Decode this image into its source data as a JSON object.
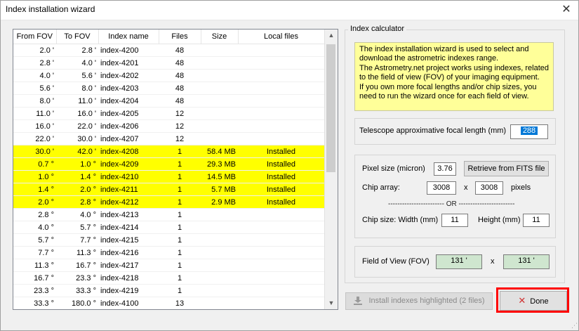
{
  "window": {
    "title": "Index installation wizard",
    "close_icon": "close-icon"
  },
  "table": {
    "headers": [
      "From FOV",
      "To FOV",
      "Index name",
      "Files",
      "Size",
      "Local files"
    ],
    "rows": [
      {
        "from": "2.0 '",
        "to": "2.8 '",
        "name": "index-4200",
        "files": "48",
        "size": "",
        "local": "",
        "hl": false
      },
      {
        "from": "2.8 '",
        "to": "4.0 '",
        "name": "index-4201",
        "files": "48",
        "size": "",
        "local": "",
        "hl": false
      },
      {
        "from": "4.0 '",
        "to": "5.6 '",
        "name": "index-4202",
        "files": "48",
        "size": "",
        "local": "",
        "hl": false
      },
      {
        "from": "5.6 '",
        "to": "8.0 '",
        "name": "index-4203",
        "files": "48",
        "size": "",
        "local": "",
        "hl": false
      },
      {
        "from": "8.0 '",
        "to": "11.0 '",
        "name": "index-4204",
        "files": "48",
        "size": "",
        "local": "",
        "hl": false
      },
      {
        "from": "11.0 '",
        "to": "16.0 '",
        "name": "index-4205",
        "files": "12",
        "size": "",
        "local": "",
        "hl": false
      },
      {
        "from": "16.0 '",
        "to": "22.0 '",
        "name": "index-4206",
        "files": "12",
        "size": "",
        "local": "",
        "hl": false
      },
      {
        "from": "22.0 '",
        "to": "30.0 '",
        "name": "index-4207",
        "files": "12",
        "size": "",
        "local": "",
        "hl": false
      },
      {
        "from": "30.0 '",
        "to": "42.0 '",
        "name": "index-4208",
        "files": "1",
        "size": "58.4 MB",
        "local": "Installed",
        "hl": true
      },
      {
        "from": "0.7 °",
        "to": "1.0 °",
        "name": "index-4209",
        "files": "1",
        "size": "29.3 MB",
        "local": "Installed",
        "hl": true
      },
      {
        "from": "1.0 °",
        "to": "1.4 °",
        "name": "index-4210",
        "files": "1",
        "size": "14.5 MB",
        "local": "Installed",
        "hl": true
      },
      {
        "from": "1.4 °",
        "to": "2.0 °",
        "name": "index-4211",
        "files": "1",
        "size": "5.7 MB",
        "local": "Installed",
        "hl": true
      },
      {
        "from": "2.0 °",
        "to": "2.8 °",
        "name": "index-4212",
        "files": "1",
        "size": "2.9 MB",
        "local": "Installed",
        "hl": true
      },
      {
        "from": "2.8 °",
        "to": "4.0 °",
        "name": "index-4213",
        "files": "1",
        "size": "",
        "local": "",
        "hl": false
      },
      {
        "from": "4.0 °",
        "to": "5.7 °",
        "name": "index-4214",
        "files": "1",
        "size": "",
        "local": "",
        "hl": false
      },
      {
        "from": "5.7 °",
        "to": "7.7 °",
        "name": "index-4215",
        "files": "1",
        "size": "",
        "local": "",
        "hl": false
      },
      {
        "from": "7.7 °",
        "to": "11.3 °",
        "name": "index-4216",
        "files": "1",
        "size": "",
        "local": "",
        "hl": false
      },
      {
        "from": "11.3 °",
        "to": "16.7 °",
        "name": "index-4217",
        "files": "1",
        "size": "",
        "local": "",
        "hl": false
      },
      {
        "from": "16.7 °",
        "to": "23.3 °",
        "name": "index-4218",
        "files": "1",
        "size": "",
        "local": "",
        "hl": false
      },
      {
        "from": "23.3 °",
        "to": "33.3 °",
        "name": "index-4219",
        "files": "1",
        "size": "",
        "local": "",
        "hl": false
      },
      {
        "from": "33.3 °",
        "to": "180.0 °",
        "name": "index-4100",
        "files": "13",
        "size": "",
        "local": "",
        "hl": false
      }
    ],
    "highlight_color": "#ffff00"
  },
  "calculator": {
    "group_title": "Index calculator",
    "info_lines": [
      "The index installation wizard is used to select and",
      "download the astrometric indexes range.",
      "The Astrometry.net project works using indexes, related",
      "to the field of view (FOV) of your imaging equipment.",
      "If you own more focal lengths and/or chip sizes, you",
      "need to run the wizard once for each field of view."
    ],
    "focal_label": "Telescope approximative focal length (mm)",
    "focal_value": "288",
    "pixel_size_label": "Pixel size (micron)",
    "pixel_size_value": "3.76",
    "retrieve_button": "Retrieve from FITS file",
    "chip_array_label": "Chip array:",
    "chip_array_w": "3008",
    "chip_array_x": "x",
    "chip_array_h": "3008",
    "chip_array_unit": "pixels",
    "or_separator": "------------------------ OR ------------------------",
    "chip_size_label": "Chip size:  Width (mm)",
    "chip_width": "11",
    "chip_height_label": "Height (mm)",
    "chip_height": "11",
    "fov_label": "Field of View  (FOV)",
    "fov_w": "131 '",
    "fov_x": "x",
    "fov_h": "131 '"
  },
  "buttons": {
    "install": "Install indexes highlighted (2 files)",
    "done": "Done"
  }
}
